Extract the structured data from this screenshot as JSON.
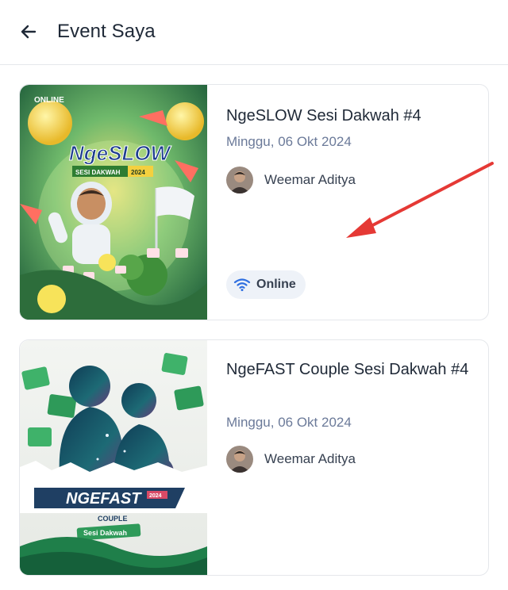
{
  "header": {
    "title": "Event Saya",
    "back_icon": "arrow-left-icon"
  },
  "events": [
    {
      "title": "NgeSLOW Sesi Dakwah #4",
      "date": "Minggu, 06 Okt 2024",
      "host": "Weemar Aditya",
      "mode": "Online",
      "mode_icon": "wifi-icon",
      "poster": {
        "top_label": "ONLINE",
        "logo_text": "NgeSLOW",
        "sub_banner": "SESI DAKWAH",
        "year": "2024"
      }
    },
    {
      "title": "NgeFAST Couple Sesi Dakwah #4",
      "date": "Minggu, 06 Okt 2024",
      "host": "Weemar Aditya",
      "poster": {
        "logo_text": "NGEFAST",
        "year": "2024",
        "sub_banner_1": "COUPLE",
        "sub_banner_2": "Sesi Dakwah"
      }
    }
  ],
  "annotation": {
    "arrow_color": "#e53935"
  }
}
